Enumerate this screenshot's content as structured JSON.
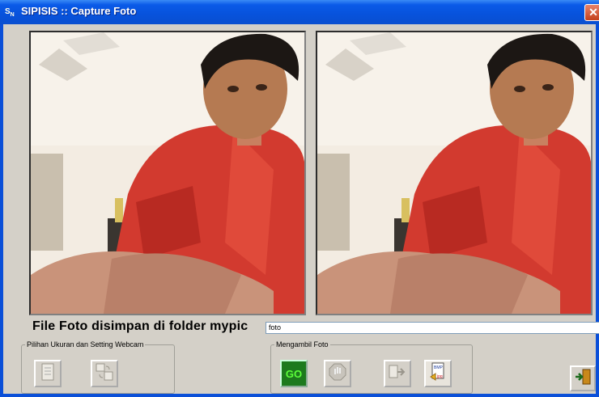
{
  "window": {
    "title": "SIPISIS :: Capture Foto",
    "app_icon": "sipisis-app-icon"
  },
  "caption": "File Foto disimpan di folder mypic",
  "filename_field": {
    "value": "foto"
  },
  "groups": {
    "webcam": {
      "legend": "Pilihan Ukuran dan Setting Webcam"
    },
    "capture": {
      "legend": "Mengambil Foto"
    }
  },
  "buttons": {
    "go_label": "GO"
  },
  "icons": {
    "size": "document-icon",
    "settings": "webcam-settings-icon",
    "go": "go-icon",
    "stop": "stop-hand-icon",
    "transfer": "copy-to-folder-icon",
    "save_jpg": "save-jpg-icon",
    "exit": "exit-door-icon"
  },
  "colors": {
    "titlebar": "#0a5ae8",
    "go": "#1d7a1d",
    "close": "#c4401c"
  }
}
